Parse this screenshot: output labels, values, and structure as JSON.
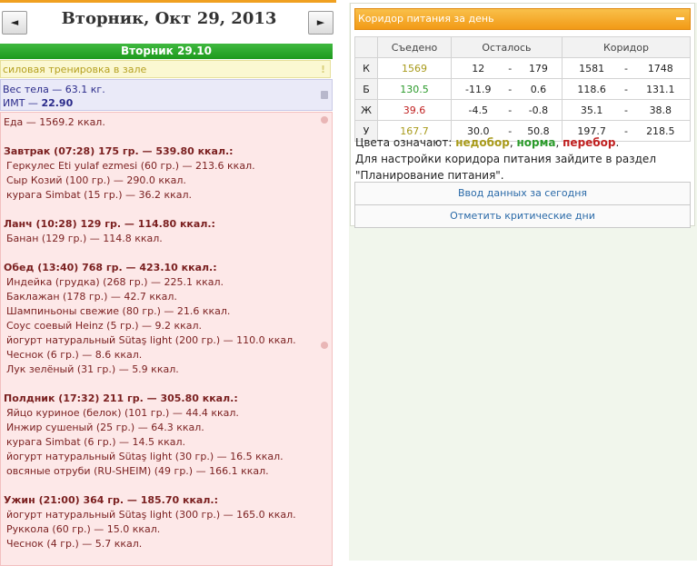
{
  "header": {
    "date_title": "Вторник, Окт 29, 2013",
    "prev_label": "◄",
    "next_label": "►",
    "day_bar": "Вторник 29.10"
  },
  "workout": {
    "text": "силовая тренировка в зале",
    "mark": "!"
  },
  "body": {
    "weight": "Вес тела — 63.1 кг.",
    "bmi_label": "ИМТ — ",
    "bmi_value": "22.90"
  },
  "food": {
    "total": "Еда — 1569.2 ккал.",
    "meals": [
      {
        "title": "Завтрак (07:28) 175 гр. — 539.80 ккал.:",
        "items": [
          "Геркулес Eti yulaf ezmesi (60 гр.) — 213.6 ккал.",
          "Сыр Козий (100 гр.) — 290.0 ккал.",
          "курага Simbat (15 гр.) — 36.2 ккал."
        ]
      },
      {
        "title": "Ланч (10:28) 129 гр. — 114.80 ккал.:",
        "items": [
          "Банан (129 гр.) — 114.8 ккал."
        ]
      },
      {
        "title": "Обед (13:40) 768 гр. — 423.10 ккал.:",
        "items": [
          "Индейка (грудка) (268 гр.) — 225.1 ккал.",
          "Баклажан (178 гр.) — 42.7 ккал.",
          "Шампиньоны свежие (80 гр.) — 21.6 ккал.",
          "Соус соевый Heinz (5 гр.) — 9.2 ккал.",
          "йогурт натуральный Sütaş light (200 гр.) — 110.0 ккал.",
          "Чеснок (6 гр.) — 8.6 ккал.",
          "Лук зелёный (31 гр.) — 5.9 ккал."
        ]
      },
      {
        "title": "Полдник (17:32) 211 гр. — 305.80 ккал.:",
        "items": [
          "Яйцо куриное (белок) (101 гр.) — 44.4 ккал.",
          "Инжир сушеный (25 гр.) — 64.3 ккал.",
          "курага Simbat (6 гр.) — 14.5 ккал.",
          "йогурт натуральный Sütaş light (30 гр.) — 16.5 ккал.",
          "овсяные отруби (RU-SHEIM) (49 гр.) — 166.1 ккал."
        ]
      },
      {
        "title": "Ужин (21:00) 364 гр. — 185.70 ккал.:",
        "items": [
          "йогурт натуральный Sütaş light (300 гр.) — 165.0 ккал.",
          "Руккола (60 гр.) — 15.0 ккал.",
          "Чеснок (4 гр.) — 5.7 ккал."
        ]
      }
    ]
  },
  "panel": {
    "title": "Коридор питания за день",
    "headers": [
      "",
      "Съедено",
      "Осталось",
      "Коридор"
    ],
    "rows": [
      {
        "label": "К",
        "eaten": "1569",
        "eaten_color": "#a89a1a",
        "rem_min": "12",
        "rem_max": "179",
        "cor_min": "1581",
        "cor_max": "1748"
      },
      {
        "label": "Б",
        "eaten": "130.5",
        "eaten_color": "#2a9a2a",
        "rem_min": "-11.9",
        "rem_max": "0.6",
        "cor_min": "118.6",
        "cor_max": "131.1"
      },
      {
        "label": "Ж",
        "eaten": "39.6",
        "eaten_color": "#c02020",
        "rem_min": "-4.5",
        "rem_max": "-0.8",
        "cor_min": "35.1",
        "cor_max": "38.8"
      },
      {
        "label": "У",
        "eaten": "167.7",
        "eaten_color": "#a89a1a",
        "rem_min": "30.0",
        "rem_max": "50.8",
        "cor_min": "197.7",
        "cor_max": "218.5"
      }
    ],
    "dash": "-",
    "legend_prefix": "Цвета означают: ",
    "legend_under": "недобор",
    "legend_sep1": ", ",
    "legend_norm": "норма",
    "legend_sep2": ", ",
    "legend_over": "перебор",
    "legend_end": ".",
    "settings_note": "Для настройки коридора питания зайдите в раздел \"Планирование питания\".",
    "btn_enter": "Ввод данных за сегодня",
    "btn_critical": "Отметить критические дни"
  }
}
